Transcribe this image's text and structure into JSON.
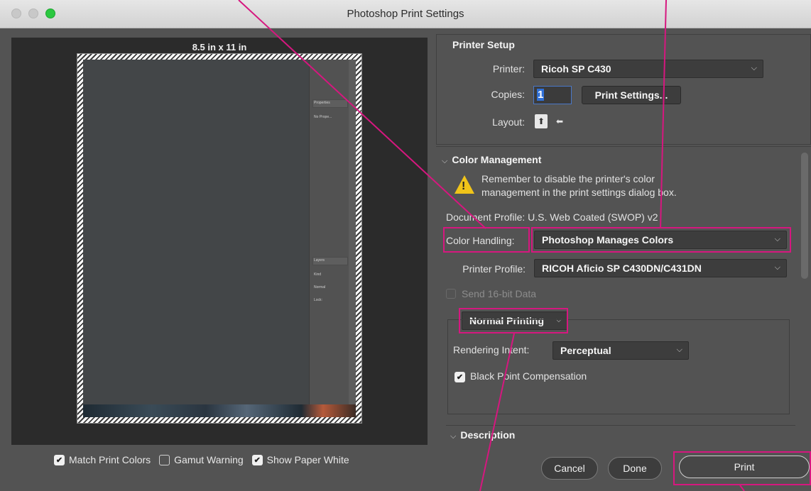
{
  "window": {
    "title": "Photoshop Print Settings"
  },
  "preview": {
    "paper_size": "8.5 in x 11 in",
    "panel_labels": {
      "properties": "Properties",
      "no_properties": "No Prope...",
      "layers": "Layers",
      "kind": "Kind",
      "normal": "Normal",
      "lock": "Lock:"
    }
  },
  "bottom_options": {
    "match_print_colors": {
      "label": "Match Print Colors",
      "checked": true
    },
    "gamut_warning": {
      "label": "Gamut Warning",
      "checked": false
    },
    "show_paper_white": {
      "label": "Show Paper White",
      "checked": true
    }
  },
  "printer_setup": {
    "title": "Printer Setup",
    "printer_label": "Printer:",
    "printer_value": "Ricoh SP C430",
    "copies_label": "Copies:",
    "copies_value": "1",
    "print_settings_button": "Print Settings...",
    "layout_label": "Layout:"
  },
  "color_management": {
    "title": "Color Management",
    "warning_line1": "Remember to disable the printer's color",
    "warning_line2": "management in the print settings dialog box.",
    "document_profile": "Document Profile: U.S. Web Coated (SWOP) v2",
    "color_handling_label": "Color Handling:",
    "color_handling_value": "Photoshop Manages Colors",
    "printer_profile_label": "Printer Profile:",
    "printer_profile_value": "RICOH Aficio SP C430DN/C431DN",
    "send_16bit_label": "Send 16-bit Data",
    "printing_mode": "Normal Printing",
    "rendering_intent_label": "Rendering Intent:",
    "rendering_intent_value": "Perceptual",
    "black_point_label": "Black Point Compensation",
    "black_point_checked": true
  },
  "description": {
    "title": "Description"
  },
  "footer": {
    "cancel": "Cancel",
    "done": "Done",
    "print": "Print"
  },
  "colors": {
    "highlight": "#d6177f",
    "warning": "#f0c419",
    "panel": "#535353"
  }
}
